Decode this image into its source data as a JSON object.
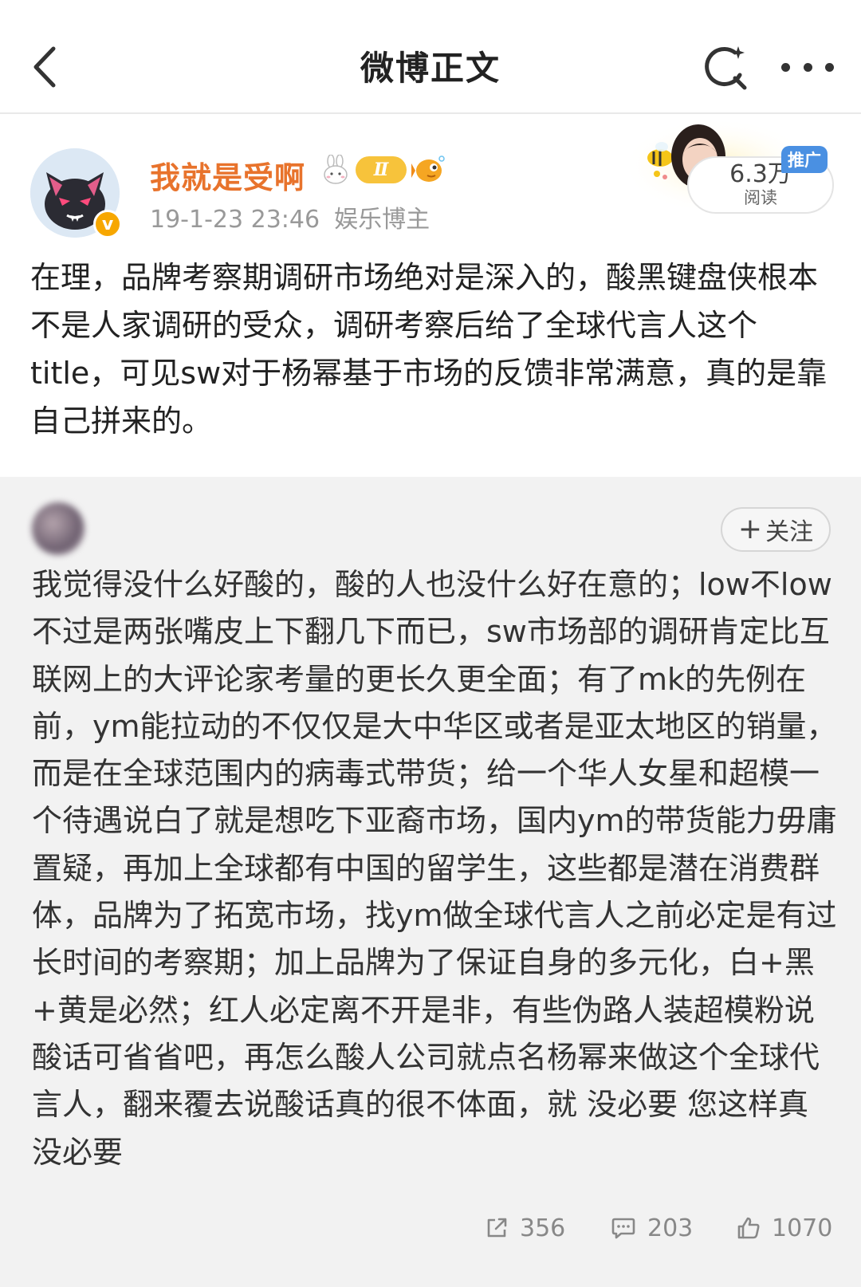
{
  "nav": {
    "title": "微博正文",
    "icons": [
      "back-icon",
      "search-icon",
      "more-icon"
    ]
  },
  "post": {
    "username": "我就是受啊",
    "level_badge": "Ⅱ",
    "verified_badge": "v",
    "time": "19-1-23 23:46",
    "source": "娱乐博主",
    "promo": {
      "reads": "6.3万",
      "reads_label": "阅读",
      "tag": "推广"
    },
    "text": "在理，品牌考察期调研市场绝对是深入的，酸黑键盘侠根本不是人家调研的受众，调研考察后给了全球代言人这个title，可见sw对于杨幂基于市场的反馈非常满意，真的是靠自己拼来的。"
  },
  "repost": {
    "follow_label": "关注",
    "text": "我觉得没什么好酸的，酸的人也没什么好在意的；low不low不过是两张嘴皮上下翻几下而已，sw市场部的调研肯定比互联网上的大评论家考量的更长久更全面；有了mk的先例在前，ym能拉动的不仅仅是大中华区或者是亚太地区的销量，而是在全球范围内的病毒式带货；给一个华人女星和超模一个待遇说白了就是想吃下亚裔市场，国内ym的带货能力毋庸置疑，再加上全球都有中国的留学生，这些都是潜在消费群体，品牌为了拓宽市场，找ym做全球代言人之前必定是有过长时间的考察期；加上品牌为了保证自身的多元化，白+黑+黄是必然；红人必定离不开是非，有些伪路人装超模粉说酸话可省省吧，再怎么酸人公司就点名杨幂来做这个全球代言人，翻来覆去说酸话真的很不体面，就 没必要 您这样真没必要",
    "actions": {
      "reposts": "356",
      "comments": "203",
      "likes": "1070"
    }
  },
  "colors": {
    "username": "#e8732c",
    "meta": "#999999",
    "repost_bg": "#f2f2f2",
    "promo_tag": "#4a90e2"
  }
}
